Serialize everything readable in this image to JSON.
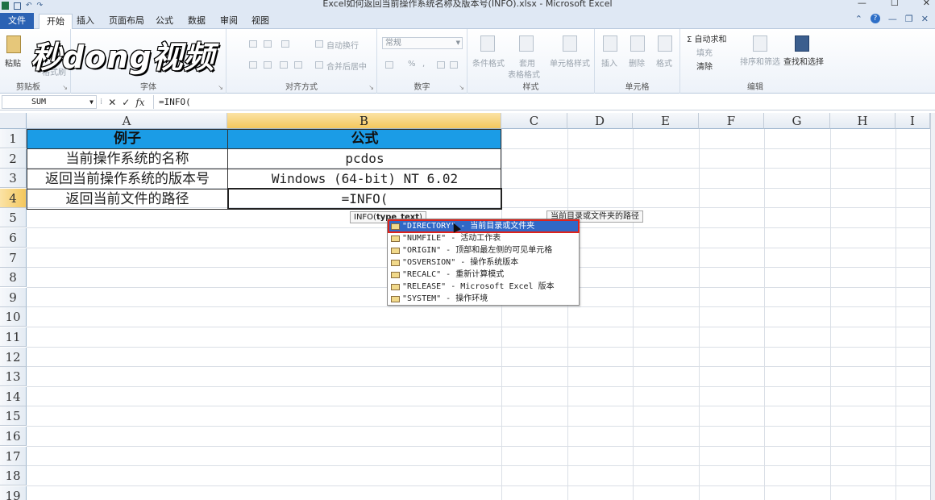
{
  "window": {
    "title": "Excel如何返回当前操作系统名称及版本号(INFO).xlsx - Microsoft Excel",
    "controls": [
      "—",
      "☐",
      "✕"
    ]
  },
  "tabs": {
    "file": "文件",
    "items": [
      "开始",
      "插入",
      "页面布局",
      "公式",
      "数据",
      "审阅",
      "视图"
    ],
    "active": "开始"
  },
  "ribbon": {
    "clipboard": {
      "paste": "粘贴",
      "format_painter": "格式刷",
      "label": "剪贴板"
    },
    "font": {
      "label": "字体"
    },
    "alignment": {
      "wrap": "自动换行",
      "merge": "合并后居中",
      "label": "对齐方式"
    },
    "number": {
      "format": "常规",
      "percent": "%",
      "comma": ",",
      "label": "数字"
    },
    "styles": {
      "conditional": "条件格式",
      "table": "套用",
      "table2": "表格格式",
      "cell_styles": "单元格样式",
      "label": "样式"
    },
    "cells": {
      "insert": "插入",
      "delete": "删除",
      "format": "格式",
      "label": "单元格"
    },
    "editing": {
      "autosum": "Σ 自动求和",
      "fill": "填充",
      "clear": "清除",
      "sort": "排序和筛选",
      "find": "查找和选择",
      "label": "编辑"
    }
  },
  "watermark": "秒dong视频",
  "formula_bar": {
    "name_box": "SUM",
    "cancel": "✕",
    "enter": "✓",
    "fx": "fx",
    "content": "=INFO("
  },
  "columns": [
    "A",
    "B",
    "C",
    "D",
    "E",
    "F",
    "G",
    "H",
    "I"
  ],
  "rows": [
    "1",
    "2",
    "3",
    "4",
    "5",
    "6",
    "7",
    "8",
    "9",
    "10",
    "11",
    "12",
    "13",
    "14",
    "15",
    "16",
    "17",
    "18",
    "19"
  ],
  "table": {
    "header": [
      "例子",
      "公式"
    ],
    "rows": [
      [
        "当前操作系统的名称",
        "pcdos"
      ],
      [
        "返回当前操作系统的版本号",
        "Windows (64-bit) NT 6.02"
      ],
      [
        "返回当前文件的路径",
        "=INFO("
      ]
    ]
  },
  "tooltip": {
    "func": "INFO(",
    "arg": "type_text",
    "close": ")"
  },
  "description_tip": "当前目录或文件夹的路径",
  "autocomplete": [
    "\"DIRECTORY\" - 当前目录或文件夹",
    "\"NUMFILE\" - 活动工作表",
    "\"ORIGIN\" - 顶部和最左侧的可见单元格",
    "\"OSVERSION\" - 操作系统版本",
    "\"RECALC\" - 重新计算模式",
    "\"RELEASE\" - Microsoft Excel 版本",
    "\"SYSTEM\" - 操作环境"
  ],
  "selected_autocomplete_index": 0,
  "colors": {
    "header_fill": "#1b9ce6",
    "selection": "#3168c6",
    "highlight_border": "#e0231b",
    "file_tab": "#2b62b4"
  }
}
